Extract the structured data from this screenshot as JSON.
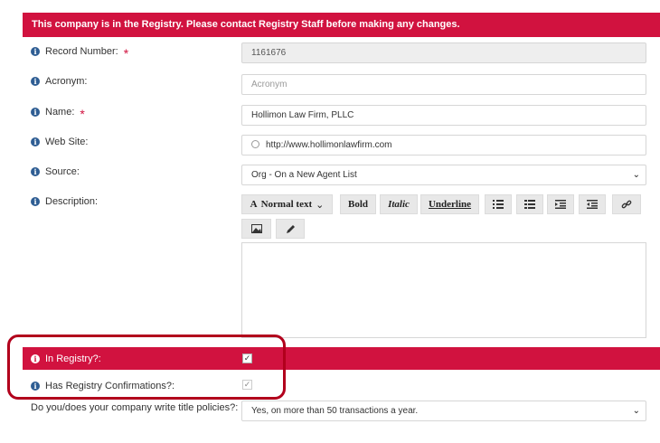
{
  "banner": {
    "text": "This company is in the Registry. Please contact Registry Staff before making any changes."
  },
  "fields": {
    "record_number": {
      "label": "Record Number:",
      "value": "1161676"
    },
    "acronym": {
      "label": "Acronym:",
      "placeholder": "Acronym"
    },
    "name": {
      "label": "Name:",
      "value": "Hollimon Law Firm, PLLC"
    },
    "website": {
      "label": "Web Site:",
      "value": "http://www.hollimonlawfirm.com"
    },
    "source": {
      "label": "Source:",
      "value": "Org - On a New Agent List"
    },
    "description": {
      "label": "Description:"
    },
    "in_registry": {
      "label": "In Registry?:",
      "checked": true
    },
    "has_confirmations": {
      "label": "Has Registry Confirmations?:",
      "checked": true
    },
    "title_policies": {
      "label": "Do you/does your company write title policies?:",
      "value": "Yes, on more than 50 transactions a year."
    }
  },
  "toolbar": {
    "format": "Normal text",
    "bold": "Bold",
    "italic": "Italic",
    "underline": "Underline"
  },
  "icons": {
    "info": "i",
    "required": "*",
    "chevron": "⌄",
    "check": "✓"
  },
  "colors": {
    "accent": "#d1123f",
    "info_icon": "#2e5d93"
  }
}
